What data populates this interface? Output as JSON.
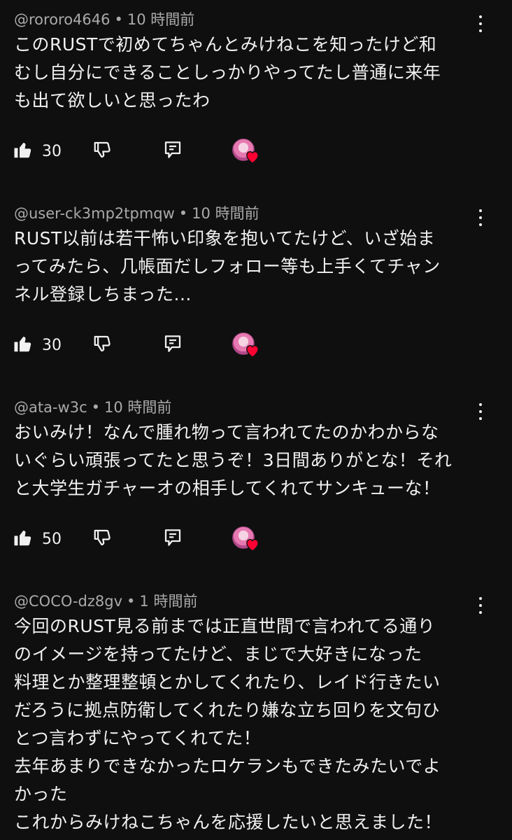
{
  "colors": {
    "background": "#0f0f0f",
    "text": "#f1f1f1",
    "meta": "#aaaaaa",
    "heart": "#ff0033"
  },
  "comments": [
    {
      "author": "@rororo4646",
      "separator": "•",
      "time": "10 時間前",
      "text": "このRUSTで初めてちゃんとみけねこを知ったけど和\nむし自分にできることしっかりやってたし普通に来年\nも出て欲しいと思ったわ",
      "likes": "30",
      "creator_heart": true
    },
    {
      "author": "@user-ck3mp2tpmqw",
      "separator": "•",
      "time": "10 時間前",
      "text": "RUST以前は若干怖い印象を抱いてたけど、いざ始ま\nってみたら、几帳面だしフォロー等も上手くてチャン\nネル登録しちまった...",
      "likes": "30",
      "creator_heart": true
    },
    {
      "author": "@ata-w3c",
      "separator": "•",
      "time": "10 時間前",
      "text": "おいみけ！なんで腫れ物って言われてたのかわからな\nいぐらい頑張ってたと思うぞ！3日間ありがとな！それ\nと大学生ガチャーオの相手してくれてサンキューな！",
      "likes": "50",
      "creator_heart": true
    },
    {
      "author": "@COCO-dz8gv",
      "separator": "•",
      "time": "1 時間前",
      "text": "今回のRUST見る前までは正直世間で言われてる通り\nのイメージを持ってたけど、まじで大好きになった\n料理とか整理整頓とかしてくれたり、レイド行きたい\nだろうに拠点防衛してくれたり嫌な立ち回りを文句ひ\nとつ言わずにやってくれてた！\n去年あまりできなかったロケランもできたみたいでよ\nかった\nこれからみけねこちゃんを応援したいと思えました！"
    }
  ]
}
